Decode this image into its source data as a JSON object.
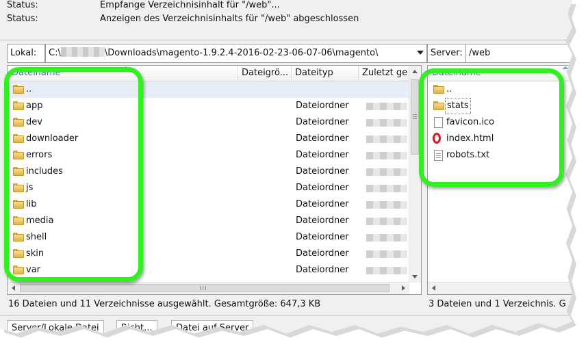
{
  "status_log": [
    {
      "key": "Status:",
      "value": "Empfange Verzeichnisinhalt für \"/web\"..."
    },
    {
      "key": "Status:",
      "value": "Anzeigen des Verzeichnisinhalts für \"/web\" abgeschlossen"
    }
  ],
  "local": {
    "label": "Lokal:",
    "path_prefix": "C:\\",
    "path_suffix": "\\Downloads\\magento-1.9.2.4-2016-02-23-06-07-06\\magento\\",
    "columns": [
      "Dateiname",
      "Dateigrö...",
      "Dateityp",
      "Zuletzt ge"
    ],
    "rows": [
      {
        "name": "..",
        "type": ""
      },
      {
        "name": "app",
        "type": "Dateiordner"
      },
      {
        "name": "dev",
        "type": "Dateiordner"
      },
      {
        "name": "downloader",
        "type": "Dateiordner"
      },
      {
        "name": "errors",
        "type": "Dateiordner"
      },
      {
        "name": "includes",
        "type": "Dateiordner"
      },
      {
        "name": "js",
        "type": "Dateiordner"
      },
      {
        "name": "lib",
        "type": "Dateiordner"
      },
      {
        "name": "media",
        "type": "Dateiordner"
      },
      {
        "name": "shell",
        "type": "Dateiordner"
      },
      {
        "name": "skin",
        "type": "Dateiordner"
      },
      {
        "name": "var",
        "type": "Dateiordner"
      }
    ],
    "status": "16 Dateien und 11 Verzeichnisse ausgewählt. Gesamtgröße: 647,3 KB"
  },
  "remote": {
    "label": "Server:",
    "path": "/web",
    "columns": [
      "Dateiname"
    ],
    "rows": [
      {
        "name": "..",
        "icon": "folder-icon"
      },
      {
        "name": "stats",
        "icon": "folder-icon"
      },
      {
        "name": "favicon.ico",
        "icon": "file-icon"
      },
      {
        "name": "index.html",
        "icon": "opera-browser-icon"
      },
      {
        "name": "robots.txt",
        "icon": "text-file-icon"
      }
    ],
    "status": "3 Dateien und 1 Verzeichnis. G"
  },
  "queue_tabs": [
    "Server/Lokale Datei",
    "Richt...",
    "Datei auf Server"
  ],
  "colors": {
    "highlight": "#33ee22",
    "opera_red": "#e0141e",
    "folder_yellow": "#f6dc8a"
  }
}
